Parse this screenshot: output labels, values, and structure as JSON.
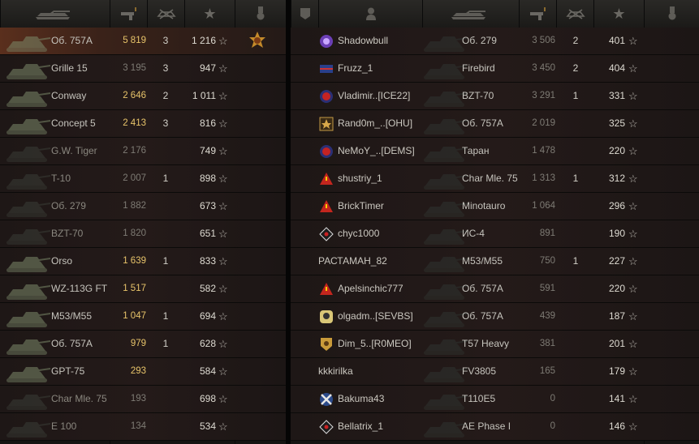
{
  "colors": {
    "damage_high": "#e8c46a",
    "damage_low": "#7e7b74",
    "self_row": "#5a2f1d"
  },
  "left_team": {
    "headers": {
      "vehicle_icon": "tank-icon",
      "damage_icon": "damage-icon",
      "frags_icon": "destroyed-icon",
      "xp_icon": "star-icon",
      "medal_icon": "medal-icon"
    },
    "rows": [
      {
        "vehicle": "Об. 757А",
        "damage": "5 819",
        "frags": "3",
        "xp": "1 216",
        "dmg_level": "high",
        "alive": true,
        "medal": true,
        "self": true
      },
      {
        "vehicle": "Grille 15",
        "damage": "3 195",
        "frags": "3",
        "xp": "947",
        "dmg_level": "low",
        "alive": true
      },
      {
        "vehicle": "Conway",
        "damage": "2 646",
        "frags": "2",
        "xp": "1 011",
        "dmg_level": "high",
        "alive": true
      },
      {
        "vehicle": "Concept 5",
        "damage": "2 413",
        "frags": "3",
        "xp": "816",
        "dmg_level": "high",
        "alive": true
      },
      {
        "vehicle": "G.W. Tiger",
        "damage": "2 176",
        "frags": "",
        "xp": "749",
        "dmg_level": "low",
        "alive": false
      },
      {
        "vehicle": "T-10",
        "damage": "2 007",
        "frags": "1",
        "xp": "898",
        "dmg_level": "low",
        "alive": false
      },
      {
        "vehicle": "Об. 279",
        "damage": "1 882",
        "frags": "",
        "xp": "673",
        "dmg_level": "low",
        "alive": false
      },
      {
        "vehicle": "BZT-70",
        "damage": "1 820",
        "frags": "",
        "xp": "651",
        "dmg_level": "low",
        "alive": false
      },
      {
        "vehicle": "Orso",
        "damage": "1 639",
        "frags": "1",
        "xp": "833",
        "dmg_level": "high",
        "alive": true
      },
      {
        "vehicle": "WZ-113G FT",
        "damage": "1 517",
        "frags": "",
        "xp": "582",
        "dmg_level": "high",
        "alive": true
      },
      {
        "vehicle": "M53/M55",
        "damage": "1 047",
        "frags": "1",
        "xp": "694",
        "dmg_level": "high",
        "alive": true
      },
      {
        "vehicle": "Об. 757А",
        "damage": "979",
        "frags": "1",
        "xp": "628",
        "dmg_level": "high",
        "alive": true
      },
      {
        "vehicle": "GPT-75",
        "damage": "293",
        "frags": "",
        "xp": "584",
        "dmg_level": "high",
        "alive": true
      },
      {
        "vehicle": "Char Mle. 75",
        "damage": "193",
        "frags": "",
        "xp": "698",
        "dmg_level": "low",
        "alive": false
      },
      {
        "vehicle": "E 100",
        "damage": "134",
        "frags": "",
        "xp": "534",
        "dmg_level": "low",
        "alive": false
      }
    ]
  },
  "right_team": {
    "headers": {
      "rank_icon": "rank-icon",
      "player_icon": "player-icon",
      "vehicle_icon": "tank-icon",
      "damage_icon": "damage-icon",
      "frags_icon": "destroyed-icon",
      "xp_icon": "star-icon",
      "medal_icon": "medal-icon"
    },
    "rows": [
      {
        "player": "Shadowbull",
        "icon": "purple-clan-icon",
        "vehicle": "Об. 279",
        "damage": "3 506",
        "frags": "2",
        "xp": "401"
      },
      {
        "player": "Fruzz_1",
        "icon": "flag-clan-icon",
        "vehicle": "Firebird",
        "damage": "3 450",
        "frags": "2",
        "xp": "404"
      },
      {
        "player": "Vladimir..[ICE22]",
        "icon": "red-clan-icon",
        "vehicle": "BZT-70",
        "damage": "3 291",
        "frags": "1",
        "xp": "331"
      },
      {
        "player": "Rand0m_..[OHU]",
        "icon": "shield-clan-icon",
        "vehicle": "Об. 757А",
        "damage": "2 019",
        "frags": "",
        "xp": "325"
      },
      {
        "player": "NeMoY_..[DEMS]",
        "icon": "red-clan-icon",
        "vehicle": "Таран",
        "damage": "1 478",
        "frags": "",
        "xp": "220"
      },
      {
        "player": "shustriy_1",
        "icon": "warning-clan-icon",
        "vehicle": "Char Mle. 75",
        "damage": "1 313",
        "frags": "1",
        "xp": "312"
      },
      {
        "player": "BrickTimer",
        "icon": "warning-clan-icon",
        "vehicle": "Minotauro",
        "damage": "1 064",
        "frags": "",
        "xp": "296"
      },
      {
        "player": "chyc1000",
        "icon": "diamond-clan-icon",
        "vehicle": "ИС-4",
        "damage": "891",
        "frags": "",
        "xp": "190"
      },
      {
        "player": "РАСТАМАН_82",
        "icon": "",
        "vehicle": "M53/M55",
        "damage": "750",
        "frags": "1",
        "xp": "227"
      },
      {
        "player": "Apelsinchic777",
        "icon": "warning-clan-icon",
        "vehicle": "Об. 757А",
        "damage": "591",
        "frags": "",
        "xp": "220"
      },
      {
        "player": "olgadm..[SEVBS]",
        "icon": "skull-clan-icon",
        "vehicle": "Об. 757А",
        "damage": "439",
        "frags": "",
        "xp": "187"
      },
      {
        "player": "Dim_5..[R0MEO]",
        "icon": "gold-clan-icon",
        "vehicle": "T57 Heavy",
        "damage": "381",
        "frags": "",
        "xp": "201"
      },
      {
        "player": "kkkirilka",
        "icon": "",
        "vehicle": "FV3805",
        "damage": "165",
        "frags": "",
        "xp": "179"
      },
      {
        "player": "Bakuma43",
        "icon": "cross-clan-icon",
        "vehicle": "T110E5",
        "damage": "0",
        "frags": "",
        "xp": "141"
      },
      {
        "player": "Bellatrix_1",
        "icon": "diamond-clan-icon",
        "vehicle": "AE Phase I",
        "damage": "0",
        "frags": "",
        "xp": "146"
      }
    ]
  },
  "star_glyph": "☆"
}
